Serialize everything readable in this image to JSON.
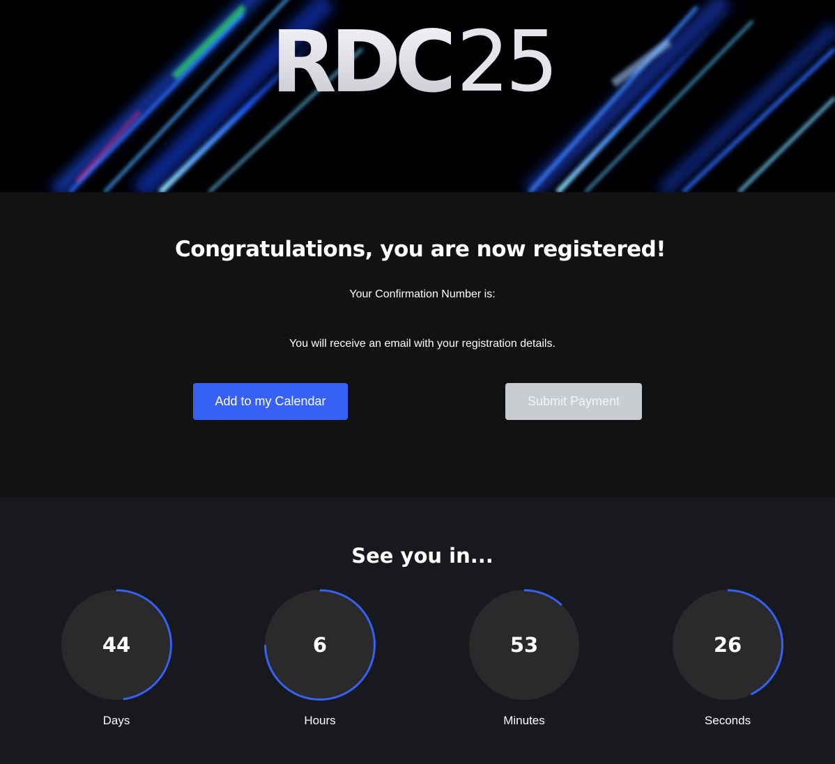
{
  "hero": {
    "logo_bold": "RDC",
    "logo_light": "25"
  },
  "confirmation": {
    "title": "Congratulations, you are now registered!",
    "number_label": "Your Confirmation Number is:",
    "email_notice": "You will receive an email with your registration details.",
    "calendar_button": "Add to my Calendar",
    "payment_button": "Submit Payment"
  },
  "countdown": {
    "title": "See you in...",
    "accent_color": "#3760f5",
    "units": [
      {
        "value": "44",
        "label": "Days",
        "progress": 0.48
      },
      {
        "value": "6",
        "label": "Hours",
        "progress": 0.75
      },
      {
        "value": "53",
        "label": "Minutes",
        "progress": 0.12
      },
      {
        "value": "26",
        "label": "Seconds",
        "progress": 0.43
      }
    ]
  }
}
